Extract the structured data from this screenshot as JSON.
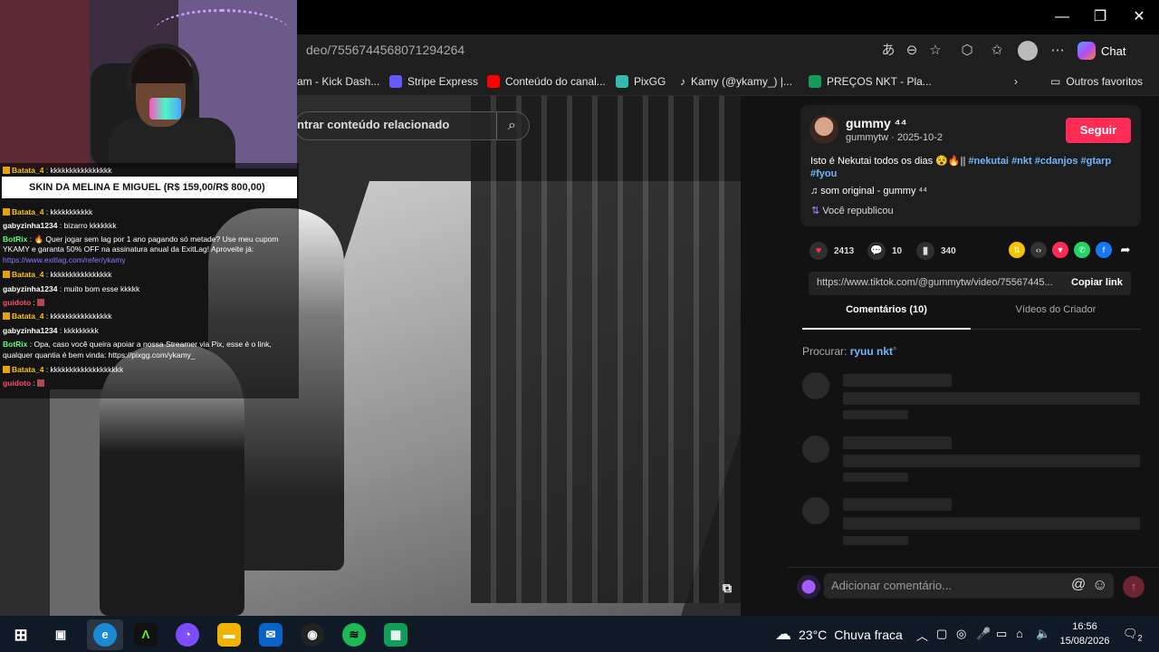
{
  "browser": {
    "url": "deo/7556744568071294264",
    "copilot_label": "Chat",
    "favorites": [
      {
        "label": "am - Kick Dash...",
        "color": "#53fc18"
      },
      {
        "label": "Stripe Express",
        "color": "#635bff"
      },
      {
        "label": "Conteúdo do canal...",
        "color": "#ff0000"
      },
      {
        "label": "PixGG",
        "color": "#32bcad"
      },
      {
        "label": "Kamy (@ykamy_) |...",
        "color": "#000000"
      },
      {
        "label": "PREÇOS NKT - Pla...",
        "color": "#0f9d58"
      }
    ],
    "other_favorites": "Outros favoritos"
  },
  "video": {
    "related_search_placeholder": "ntrar conteúdo relacionado"
  },
  "stream_overlay": {
    "banner": "SKIN DA MELINA E MIGUEL (R$ 159,00/R$ 800,00)",
    "chat": [
      {
        "user": "Batata_4",
        "text": ": kkkkkkkkkkkkkkkk",
        "color": "#f5c518"
      },
      {
        "user": "Batata_4",
        "text": ": kkkkkkkkkkk",
        "color": "#f5c518"
      },
      {
        "user": "gabyzinha1234",
        "text": ": bizarro kkkkkkk",
        "color": "#ffffff"
      },
      {
        "user": "BotRix",
        "text": ": 🔥 Quer jogar sem lag por 1 ano pagando só metade? Use meu cupom",
        "color": "#5cff7a"
      },
      {
        "user": "",
        "text": "YKAMY e garanta 50% OFF na assinatura anual da ExitLag! Aproveite já:",
        "color": "#ffffff"
      },
      {
        "user": "",
        "text": "https://www.exitlag.com/refer/ykamy",
        "color": "#8f7bff"
      },
      {
        "user": "Batata_4",
        "text": ": kkkkkkkkkkkkkkkk",
        "color": "#f5c518"
      },
      {
        "user": "gabyzinha1234",
        "text": ": muito bom esse kkkkk",
        "color": "#ffffff"
      },
      {
        "user": "guidoto",
        "text": ":",
        "color": "#ff4d6d"
      },
      {
        "user": "Batata_4",
        "text": ": kkkkkkkkkkkkkkkk",
        "color": "#f5c518"
      },
      {
        "user": "gabyzinha1234",
        "text": ": kkkkkkkkk",
        "color": "#ffffff"
      },
      {
        "user": "BotRix",
        "text": ": Opa, caso você queira apoiar a nossa Streamer via Pix, esse é o link,",
        "color": "#5cff7a"
      },
      {
        "user": "",
        "text": "qualquer quantia é bem vinda: https://pixgg.com/ykamy_",
        "color": "#ffffff"
      },
      {
        "user": "Batata_4",
        "text": ": kkkkkkkkkkkkkkkkkkk",
        "color": "#f5c518"
      },
      {
        "user": "guidoto",
        "text": ":",
        "color": "#ff4d6d"
      }
    ]
  },
  "post": {
    "author_name": "gummy ⁴⁴",
    "author_meta": "gummytw · 2025-10-2",
    "follow_label": "Seguir",
    "caption_text": "Isto é Nekutai todos os dias 😵🔥||",
    "hashtags": [
      "#nekutai",
      "#nkt",
      "#cdanjos",
      "#gtarp",
      "#fyou"
    ],
    "sound": "♫  som original - gummy ⁴⁴",
    "reposted": "Você republicou",
    "likes": "2413",
    "comments": "10",
    "saves": "340",
    "link": "https://www.tiktok.com/@gummytw/video/75567445...",
    "copy_link_label": "Copiar link",
    "tab_comments": "Comentários (10)",
    "tab_creator": "Vídeos do Criador",
    "search_prefix": "Procurar:",
    "search_term": "ryuu nkt",
    "comment_placeholder": "Adicionar comentário..."
  },
  "taskbar": {
    "temperature": "23°C",
    "weather": "Chuva fraca",
    "time": "16:56",
    "date": "15/08/2026",
    "notifications": "2"
  }
}
